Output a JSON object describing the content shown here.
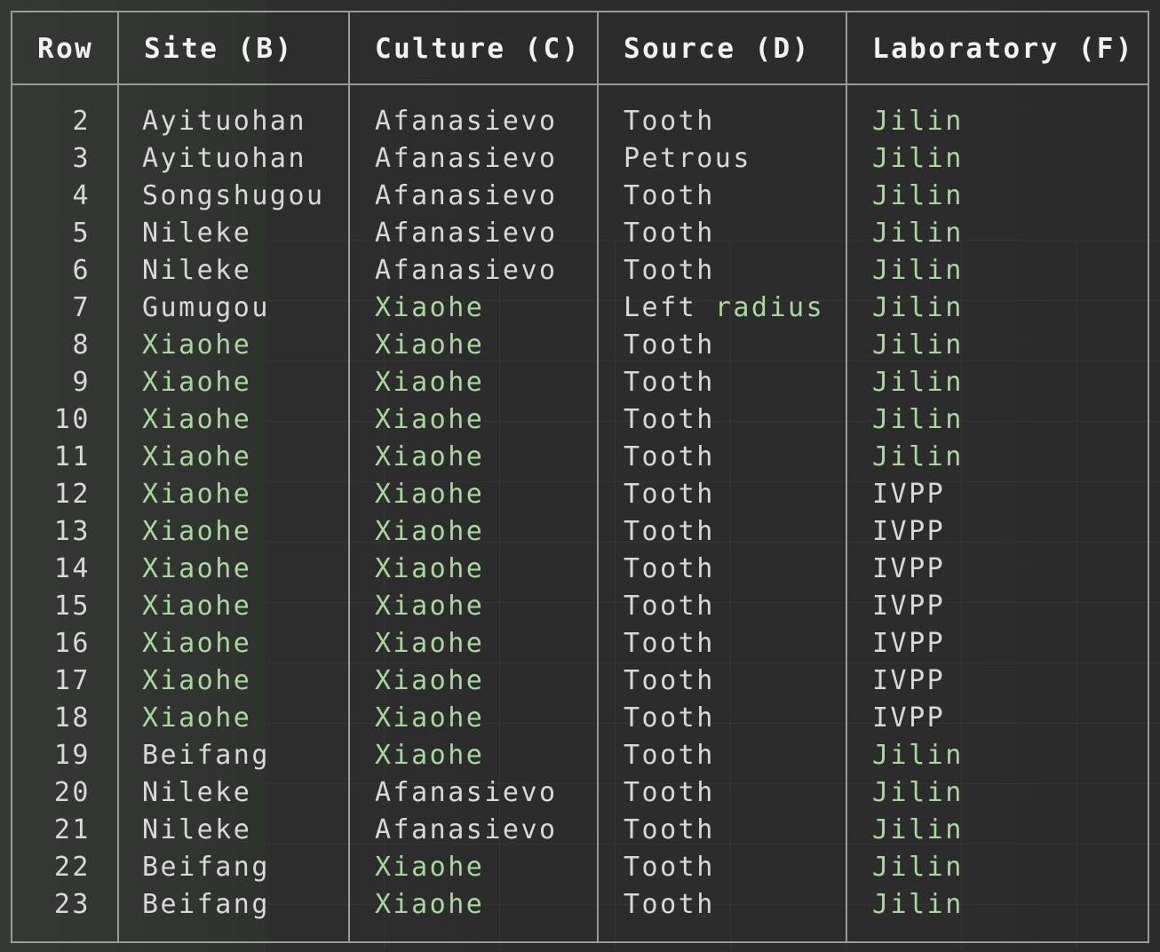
{
  "colors": {
    "text": "#d8d8d8",
    "highlight": "#a6d99a",
    "border": "#9a9a9a",
    "background": "#2b2b2b"
  },
  "headers": [
    "Row",
    "Site (B)",
    "Culture (C)",
    "Source (D)",
    "Laboratory (F)"
  ],
  "rows": [
    {
      "row": "2",
      "site": "Ayituohan",
      "culture": "Afanasievo",
      "source": "Tooth",
      "lab": "Jilin"
    },
    {
      "row": "3",
      "site": "Ayituohan",
      "culture": "Afanasievo",
      "source": "Petrous",
      "lab": "Jilin"
    },
    {
      "row": "4",
      "site": "Songshugou",
      "culture": "Afanasievo",
      "source": "Tooth",
      "lab": "Jilin"
    },
    {
      "row": "5",
      "site": "Nileke",
      "culture": "Afanasievo",
      "source": "Tooth",
      "lab": "Jilin"
    },
    {
      "row": "6",
      "site": "Nileke",
      "culture": "Afanasievo",
      "source": "Tooth",
      "lab": "Jilin"
    },
    {
      "row": "7",
      "site": "Gumugou",
      "culture": "Xiaohe",
      "source": "Left radius",
      "lab": "Jilin"
    },
    {
      "row": "8",
      "site": "Xiaohe",
      "culture": "Xiaohe",
      "source": "Tooth",
      "lab": "Jilin"
    },
    {
      "row": "9",
      "site": "Xiaohe",
      "culture": "Xiaohe",
      "source": "Tooth",
      "lab": "Jilin"
    },
    {
      "row": "10",
      "site": "Xiaohe",
      "culture": "Xiaohe",
      "source": "Tooth",
      "lab": "Jilin"
    },
    {
      "row": "11",
      "site": "Xiaohe",
      "culture": "Xiaohe",
      "source": "Tooth",
      "lab": "Jilin"
    },
    {
      "row": "12",
      "site": "Xiaohe",
      "culture": "Xiaohe",
      "source": "Tooth",
      "lab": "IVPP"
    },
    {
      "row": "13",
      "site": "Xiaohe",
      "culture": "Xiaohe",
      "source": "Tooth",
      "lab": "IVPP"
    },
    {
      "row": "14",
      "site": "Xiaohe",
      "culture": "Xiaohe",
      "source": "Tooth",
      "lab": "IVPP"
    },
    {
      "row": "15",
      "site": "Xiaohe",
      "culture": "Xiaohe",
      "source": "Tooth",
      "lab": "IVPP"
    },
    {
      "row": "16",
      "site": "Xiaohe",
      "culture": "Xiaohe",
      "source": "Tooth",
      "lab": "IVPP"
    },
    {
      "row": "17",
      "site": "Xiaohe",
      "culture": "Xiaohe",
      "source": "Tooth",
      "lab": "IVPP"
    },
    {
      "row": "18",
      "site": "Xiaohe",
      "culture": "Xiaohe",
      "source": "Tooth",
      "lab": "IVPP"
    },
    {
      "row": "19",
      "site": "Beifang",
      "culture": "Xiaohe",
      "source": "Tooth",
      "lab": "Jilin"
    },
    {
      "row": "20",
      "site": "Nileke",
      "culture": "Afanasievo",
      "source": "Tooth",
      "lab": "Jilin"
    },
    {
      "row": "21",
      "site": "Nileke",
      "culture": "Afanasievo",
      "source": "Tooth",
      "lab": "Jilin"
    },
    {
      "row": "22",
      "site": "Beifang",
      "culture": "Xiaohe",
      "source": "Tooth",
      "lab": "Jilin"
    },
    {
      "row": "23",
      "site": "Beifang",
      "culture": "Xiaohe",
      "source": "Tooth",
      "lab": "Jilin"
    }
  ]
}
